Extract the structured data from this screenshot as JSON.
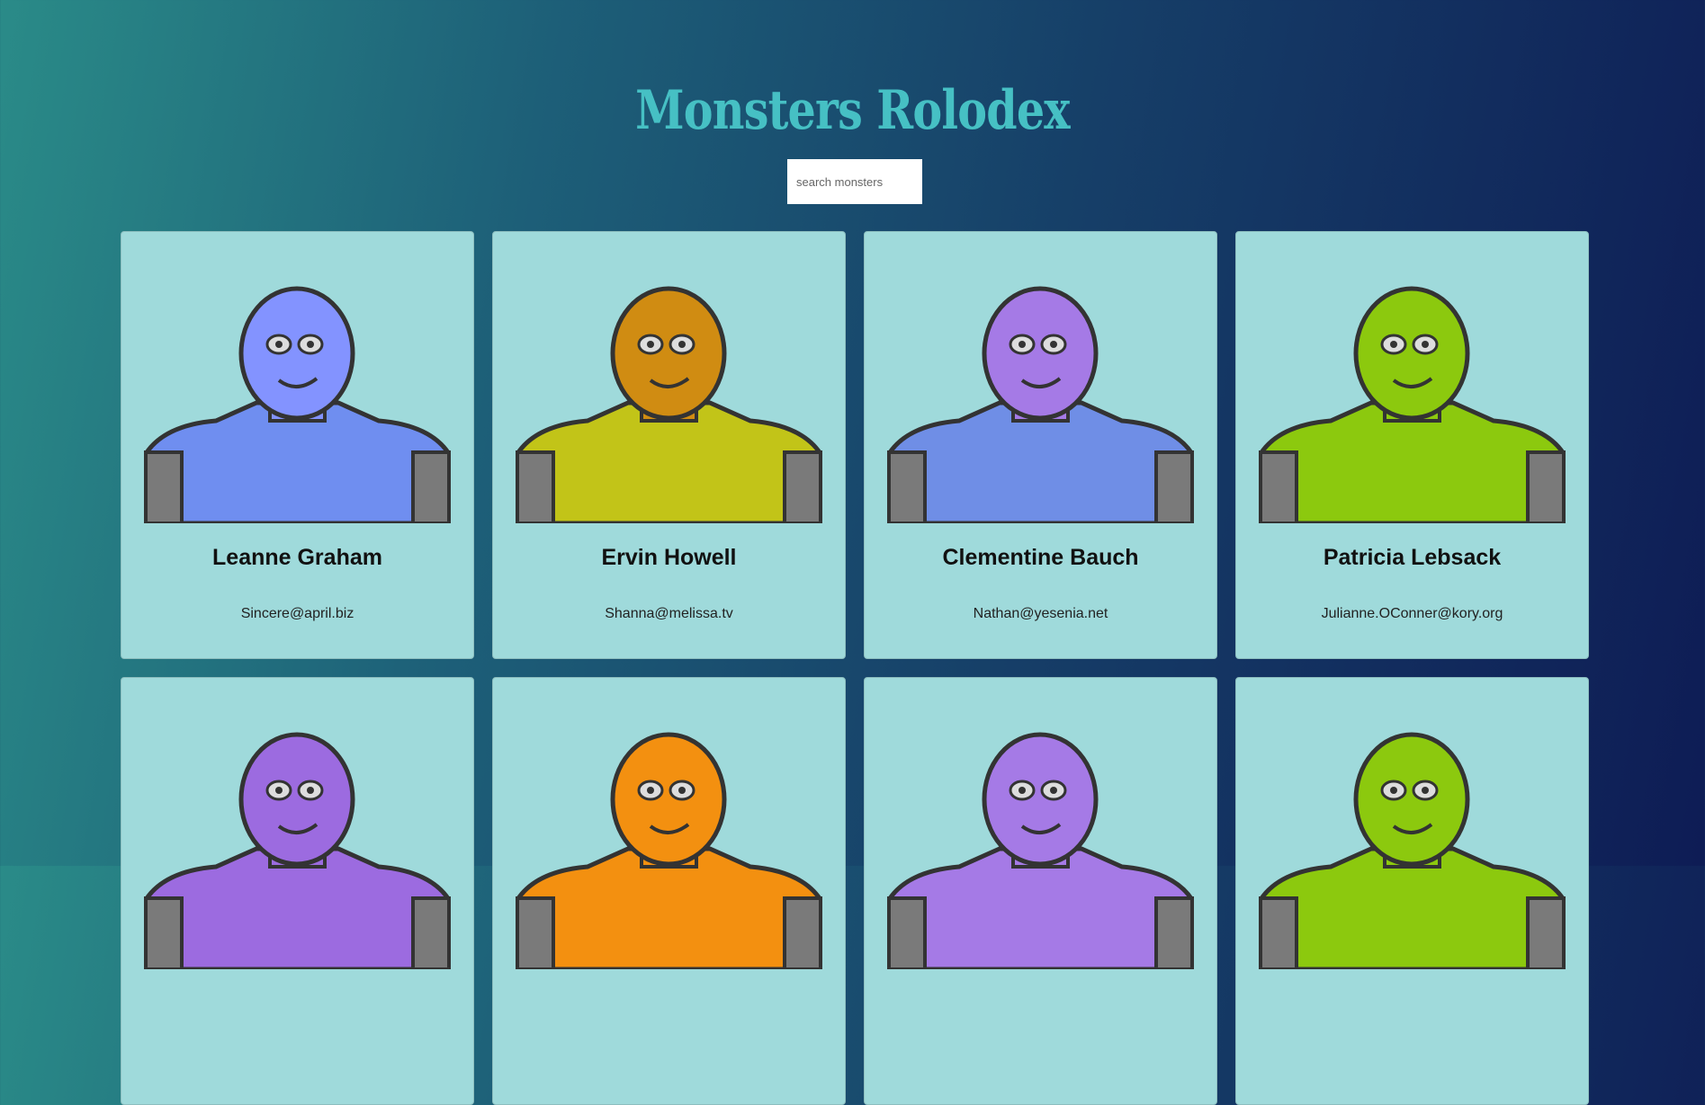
{
  "header": {
    "title": "Monsters Rolodex"
  },
  "search": {
    "placeholder": "search monsters",
    "value": ""
  },
  "monsters": [
    {
      "name": "Leanne Graham",
      "email": "Sincere@april.biz",
      "color": "#8393ff",
      "body": "#6f8ef0",
      "icon": "horned-blue-monster-icon"
    },
    {
      "name": "Ervin Howell",
      "email": "Shanna@melissa.tv",
      "color": "#d08c12",
      "body": "#c2c418",
      "icon": "orange-grinning-monster-icon"
    },
    {
      "name": "Clementine Bauch",
      "email": "Nathan@yesenia.net",
      "color": "#a57ae6",
      "body": "#6f8ee6",
      "icon": "purple-three-eyed-monster-icon"
    },
    {
      "name": "Patricia Lebsack",
      "email": "Julianne.OConner@kory.org",
      "color": "#8cc90e",
      "body": "#8cc90e",
      "icon": "green-helmet-monster-icon"
    },
    {
      "name": "",
      "email": "",
      "color": "#9c6be0",
      "body": "#9c6be0",
      "icon": "purple-robot-monster-icon"
    },
    {
      "name": "",
      "email": "",
      "color": "#f39010",
      "body": "#f39010",
      "icon": "orange-robot-monster-icon"
    },
    {
      "name": "",
      "email": "",
      "color": "#a57ae6",
      "body": "#a57ae6",
      "icon": "purple-horned-monster-icon"
    },
    {
      "name": "",
      "email": "",
      "color": "#8cc90e",
      "body": "#8cc90e",
      "icon": "green-robot-monster-icon"
    }
  ]
}
